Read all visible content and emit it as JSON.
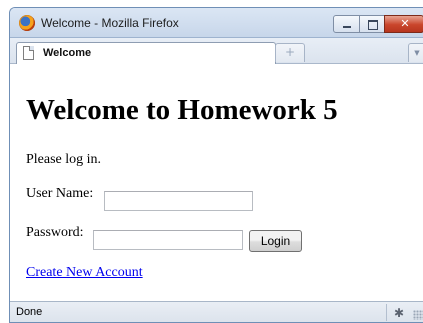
{
  "window": {
    "title": "Welcome - Mozilla Firefox",
    "icon": "firefox-logo-icon",
    "controls": [
      "minimize-icon",
      "maximize-icon",
      "close-icon"
    ]
  },
  "tabs": {
    "items": [
      {
        "label": "Welcome",
        "icon": "document-icon",
        "active": true
      }
    ],
    "new_tab_symbol": "+",
    "list_symbol": "▼"
  },
  "page": {
    "heading": "Welcome to Homework 5",
    "intro": "Please log in.",
    "username": {
      "label": "User Name:",
      "value": ""
    },
    "password": {
      "label": "Password:",
      "value": ""
    },
    "login_button": "Login",
    "create_account_link": "Create New Account"
  },
  "status": {
    "text": "Done",
    "addon_icon": "addon-status-icon"
  },
  "colors": {
    "link": "#0000ee",
    "close_button": "#c9452b",
    "titlebar": "#c7d6ea"
  }
}
